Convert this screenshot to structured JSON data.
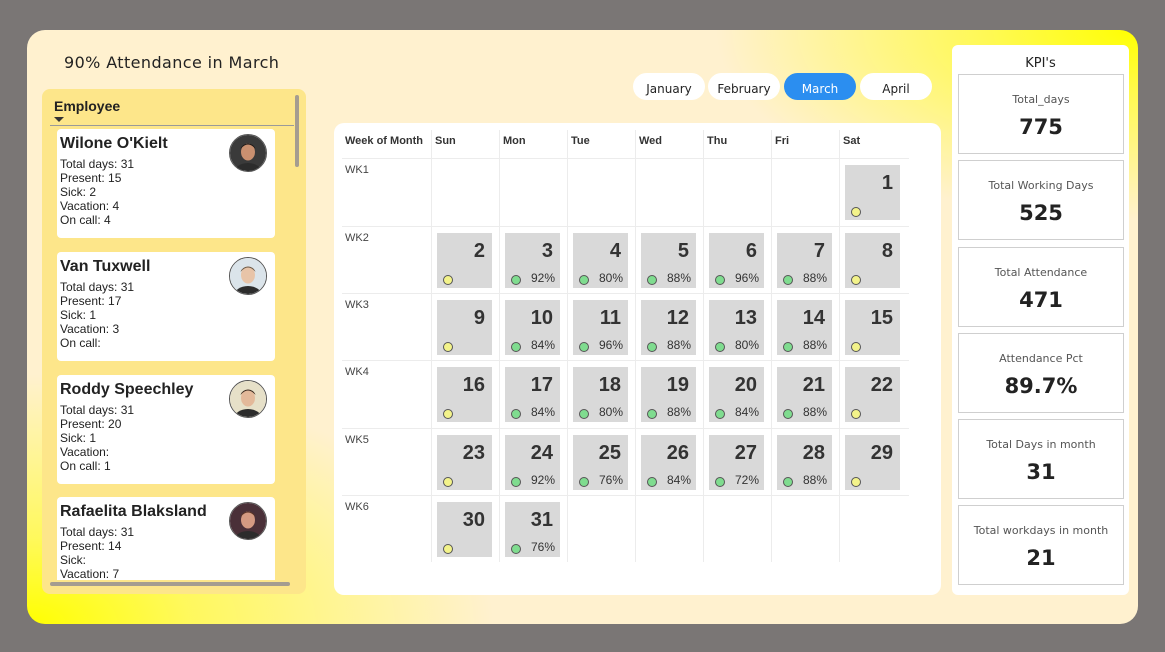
{
  "title": "90% Attendance in March",
  "employee_panel": {
    "header": "Employee",
    "employees": [
      {
        "name": "Wilone O'Kielt",
        "lines": [
          "Total days: 31",
          "Present: 15",
          "Sick: 2",
          "Vacation: 4",
          "On call: 4"
        ]
      },
      {
        "name": "Van Tuxwell",
        "lines": [
          "Total days: 31",
          "Present: 17",
          "Sick: 1",
          "Vacation: 3",
          "On call:"
        ]
      },
      {
        "name": "Roddy Speechley",
        "lines": [
          "Total days: 31",
          "Present: 20",
          "Sick: 1",
          "Vacation:",
          "On call: 1"
        ]
      },
      {
        "name": "Rafaelita Blaksland",
        "lines": [
          "Total days: 31",
          "Present: 14",
          "Sick:",
          "Vacation: 7"
        ]
      }
    ]
  },
  "months": {
    "tabs": [
      "January",
      "February",
      "March",
      "April"
    ],
    "selected": "March"
  },
  "calendar": {
    "headers": [
      "Week of Month",
      "Sun",
      "Mon",
      "Tue",
      "Wed",
      "Thu",
      "Fri",
      "Sat"
    ],
    "weeks": [
      "WK1",
      "WK2",
      "WK3",
      "WK4",
      "WK5",
      "WK6"
    ],
    "days": [
      {
        "num": "1",
        "pct": "",
        "status": "weekend"
      },
      {
        "num": "2",
        "pct": "",
        "status": "weekend"
      },
      {
        "num": "3",
        "pct": "92%",
        "status": "working"
      },
      {
        "num": "4",
        "pct": "80%",
        "status": "working"
      },
      {
        "num": "5",
        "pct": "88%",
        "status": "working"
      },
      {
        "num": "6",
        "pct": "96%",
        "status": "working"
      },
      {
        "num": "7",
        "pct": "88%",
        "status": "working"
      },
      {
        "num": "8",
        "pct": "",
        "status": "weekend"
      },
      {
        "num": "9",
        "pct": "",
        "status": "weekend"
      },
      {
        "num": "10",
        "pct": "84%",
        "status": "working"
      },
      {
        "num": "11",
        "pct": "96%",
        "status": "working"
      },
      {
        "num": "12",
        "pct": "88%",
        "status": "working"
      },
      {
        "num": "13",
        "pct": "80%",
        "status": "working"
      },
      {
        "num": "14",
        "pct": "88%",
        "status": "working"
      },
      {
        "num": "15",
        "pct": "",
        "status": "weekend"
      },
      {
        "num": "16",
        "pct": "",
        "status": "weekend"
      },
      {
        "num": "17",
        "pct": "84%",
        "status": "working"
      },
      {
        "num": "18",
        "pct": "80%",
        "status": "working"
      },
      {
        "num": "19",
        "pct": "88%",
        "status": "working"
      },
      {
        "num": "20",
        "pct": "84%",
        "status": "working"
      },
      {
        "num": "21",
        "pct": "88%",
        "status": "working"
      },
      {
        "num": "22",
        "pct": "",
        "status": "weekend"
      },
      {
        "num": "23",
        "pct": "",
        "status": "weekend"
      },
      {
        "num": "24",
        "pct": "92%",
        "status": "working"
      },
      {
        "num": "25",
        "pct": "76%",
        "status": "working"
      },
      {
        "num": "26",
        "pct": "84%",
        "status": "working"
      },
      {
        "num": "27",
        "pct": "72%",
        "status": "working"
      },
      {
        "num": "28",
        "pct": "88%",
        "status": "working"
      },
      {
        "num": "29",
        "pct": "",
        "status": "weekend"
      },
      {
        "num": "30",
        "pct": "",
        "status": "weekend"
      },
      {
        "num": "31",
        "pct": "76%",
        "status": "working"
      }
    ],
    "colors": {
      "working_dot": "#7fdc8f",
      "weekend_dot": "#f3f38a",
      "cell": "#d9d9d9"
    }
  },
  "kpi": {
    "title": "KPI's",
    "items": [
      {
        "label": "Total_days",
        "value": "775"
      },
      {
        "label": "Total Working Days",
        "value": "525"
      },
      {
        "label": "Total Attendance",
        "value": "471"
      },
      {
        "label": "Attendance Pct",
        "value": "89.7%"
      },
      {
        "label": "Total Days in month",
        "value": "31"
      },
      {
        "label": "Total workdays in month",
        "value": "21"
      }
    ]
  },
  "colors": {
    "accent": "#2b8ef0",
    "panel": "#fde68a",
    "background": "#7a7675"
  }
}
